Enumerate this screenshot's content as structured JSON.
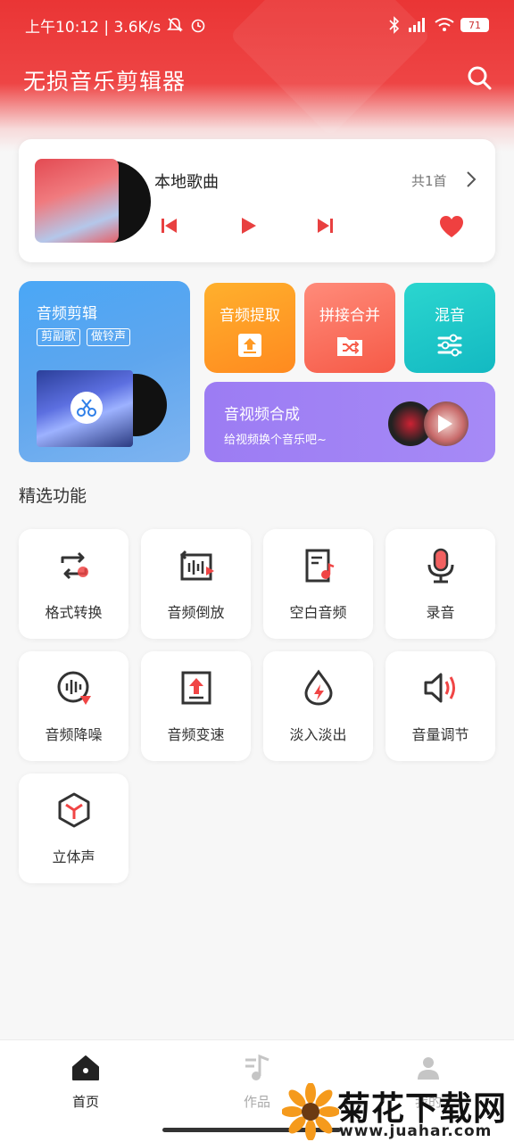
{
  "status_bar": {
    "time_speed": "上午10:12 | 3.6K/s",
    "battery": "71"
  },
  "header": {
    "title": "无损音乐剪辑器"
  },
  "player": {
    "song_title": "本地歌曲",
    "count": "共1首"
  },
  "cards": {
    "audio_edit": {
      "label": "音频剪辑",
      "tags": [
        "剪副歌",
        "做铃声"
      ]
    },
    "extract": {
      "label": "音频提取"
    },
    "join": {
      "label": "拼接合并"
    },
    "mix": {
      "label": "混音"
    },
    "av_merge": {
      "label": "音视频合成",
      "sub": "给视频换个音乐吧~"
    }
  },
  "section": {
    "title": "精选功能"
  },
  "features": [
    {
      "label": "格式转换"
    },
    {
      "label": "音频倒放"
    },
    {
      "label": "空白音频"
    },
    {
      "label": "录音"
    },
    {
      "label": "音频降噪"
    },
    {
      "label": "音频变速"
    },
    {
      "label": "淡入淡出"
    },
    {
      "label": "音量调节"
    },
    {
      "label": "立体声"
    }
  ],
  "nav": {
    "home": "首页",
    "works": "作品",
    "me": "我的"
  },
  "watermark": {
    "title": "菊花下载网",
    "url": "www.juahar.com"
  },
  "colors": {
    "primary_red": "#ea3535",
    "blue": "#4aa7f6",
    "orange": "#ff9a25",
    "coral": "#f65a47",
    "teal": "#13b9c2",
    "purple": "#9c7cf3"
  }
}
